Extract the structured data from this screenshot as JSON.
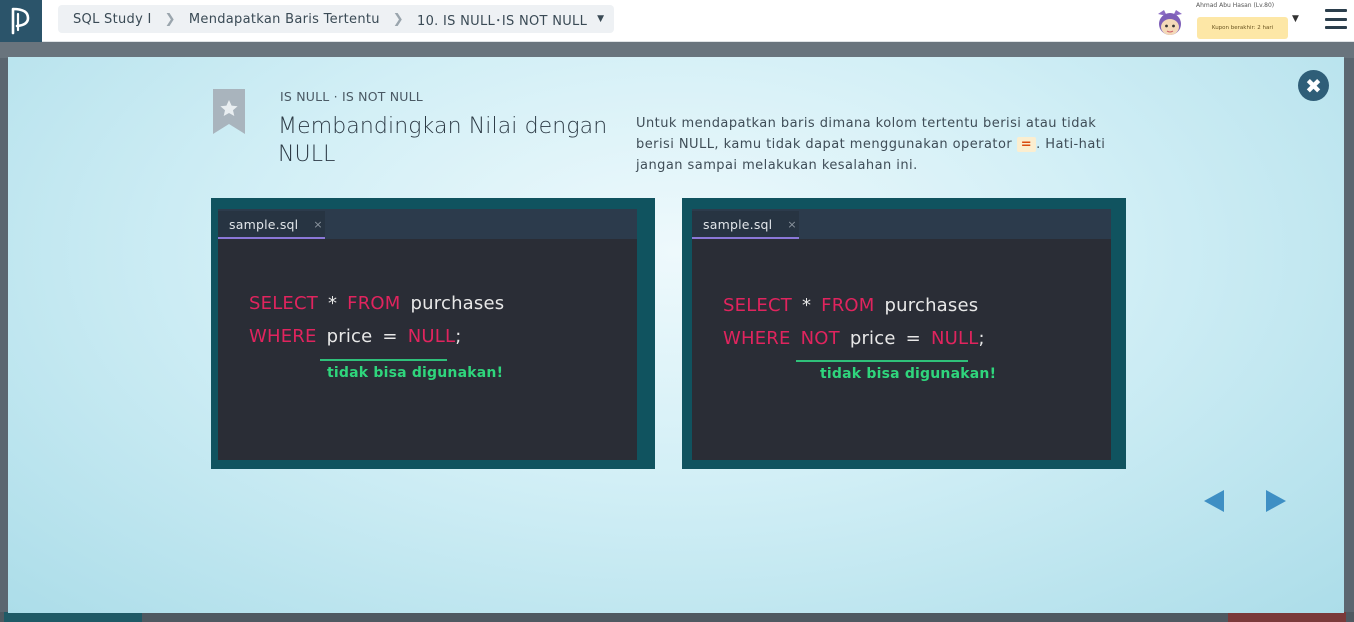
{
  "header": {
    "breadcrumb": [
      "SQL Study I",
      "Mendapatkan Baris Tertentu",
      "10. IS NULL･IS NOT NULL"
    ],
    "user_name": "Ahmad Abu Hasan (Lv.80)",
    "coupon_text": "Kupon berakhir: 2 hari"
  },
  "slide": {
    "subtitle": "IS NULL · IS NOT NULL",
    "title": "Membandingkan Nilai dengan NULL",
    "description_before": "Untuk mendapatkan baris dimana kolom tertentu berisi atau tidak berisi NULL, kamu tidak dapat menggunakan operator ",
    "operator": "=",
    "description_after": ". Hati-hati jangan sampai melakukan kesalahan ini."
  },
  "panels": [
    {
      "tab_label": "sample.sql",
      "tab_close": "×",
      "line1": {
        "kw1": "SELECT",
        "op": "*",
        "kw2": "FROM",
        "table": "purchases"
      },
      "line2": {
        "kw": "WHERE",
        "col": "price",
        "eq": "=",
        "kw_null": "NULL",
        "end": ";"
      },
      "warning": "tidak bisa digunakan!"
    },
    {
      "tab_label": "sample.sql",
      "tab_close": "×",
      "line1": {
        "kw1": "SELECT",
        "op": "*",
        "kw2": "FROM",
        "table": "purchases"
      },
      "line2": {
        "kw": "WHERE",
        "kw_not": "NOT",
        "col": "price",
        "eq": "=",
        "kw_null": "NULL",
        "end": ";"
      },
      "warning": "tidak bisa digunakan!"
    }
  ],
  "colors": {
    "keyword": "#e0245e",
    "warning": "#2fd57c",
    "panel_frame": "#10535f",
    "close_button": "#2f5e78",
    "nav_arrow": "#3e8fc4"
  },
  "icons": {
    "logo": "progate-logo-icon",
    "close": "close-icon",
    "bookmark": "bookmark-star-icon",
    "prev": "arrow-left-icon",
    "next": "arrow-right-icon",
    "menu": "hamburger-menu-icon"
  }
}
